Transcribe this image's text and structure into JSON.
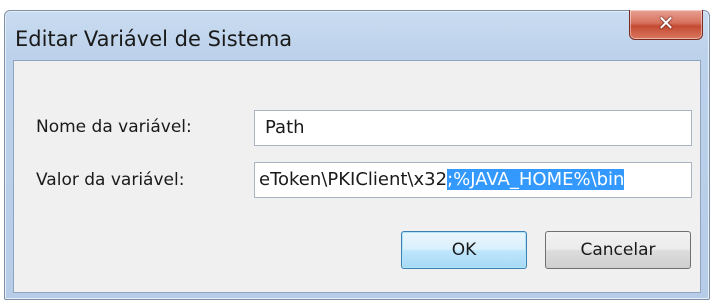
{
  "window": {
    "title": "Editar Variável de Sistema",
    "close_icon": "close-icon"
  },
  "form": {
    "name_label": "Nome da variável:",
    "name_value": "Path",
    "value_label": "Valor da variável:",
    "value_unselected": "eToken\\PKIClient\\x32",
    "value_selected": ";%JAVA_HOME%\\bin"
  },
  "buttons": {
    "ok": "OK",
    "cancel": "Cancelar"
  },
  "colors": {
    "selection": "#3399ff",
    "close_button": "#c44a32",
    "default_button_border": "#3c7fb1"
  }
}
